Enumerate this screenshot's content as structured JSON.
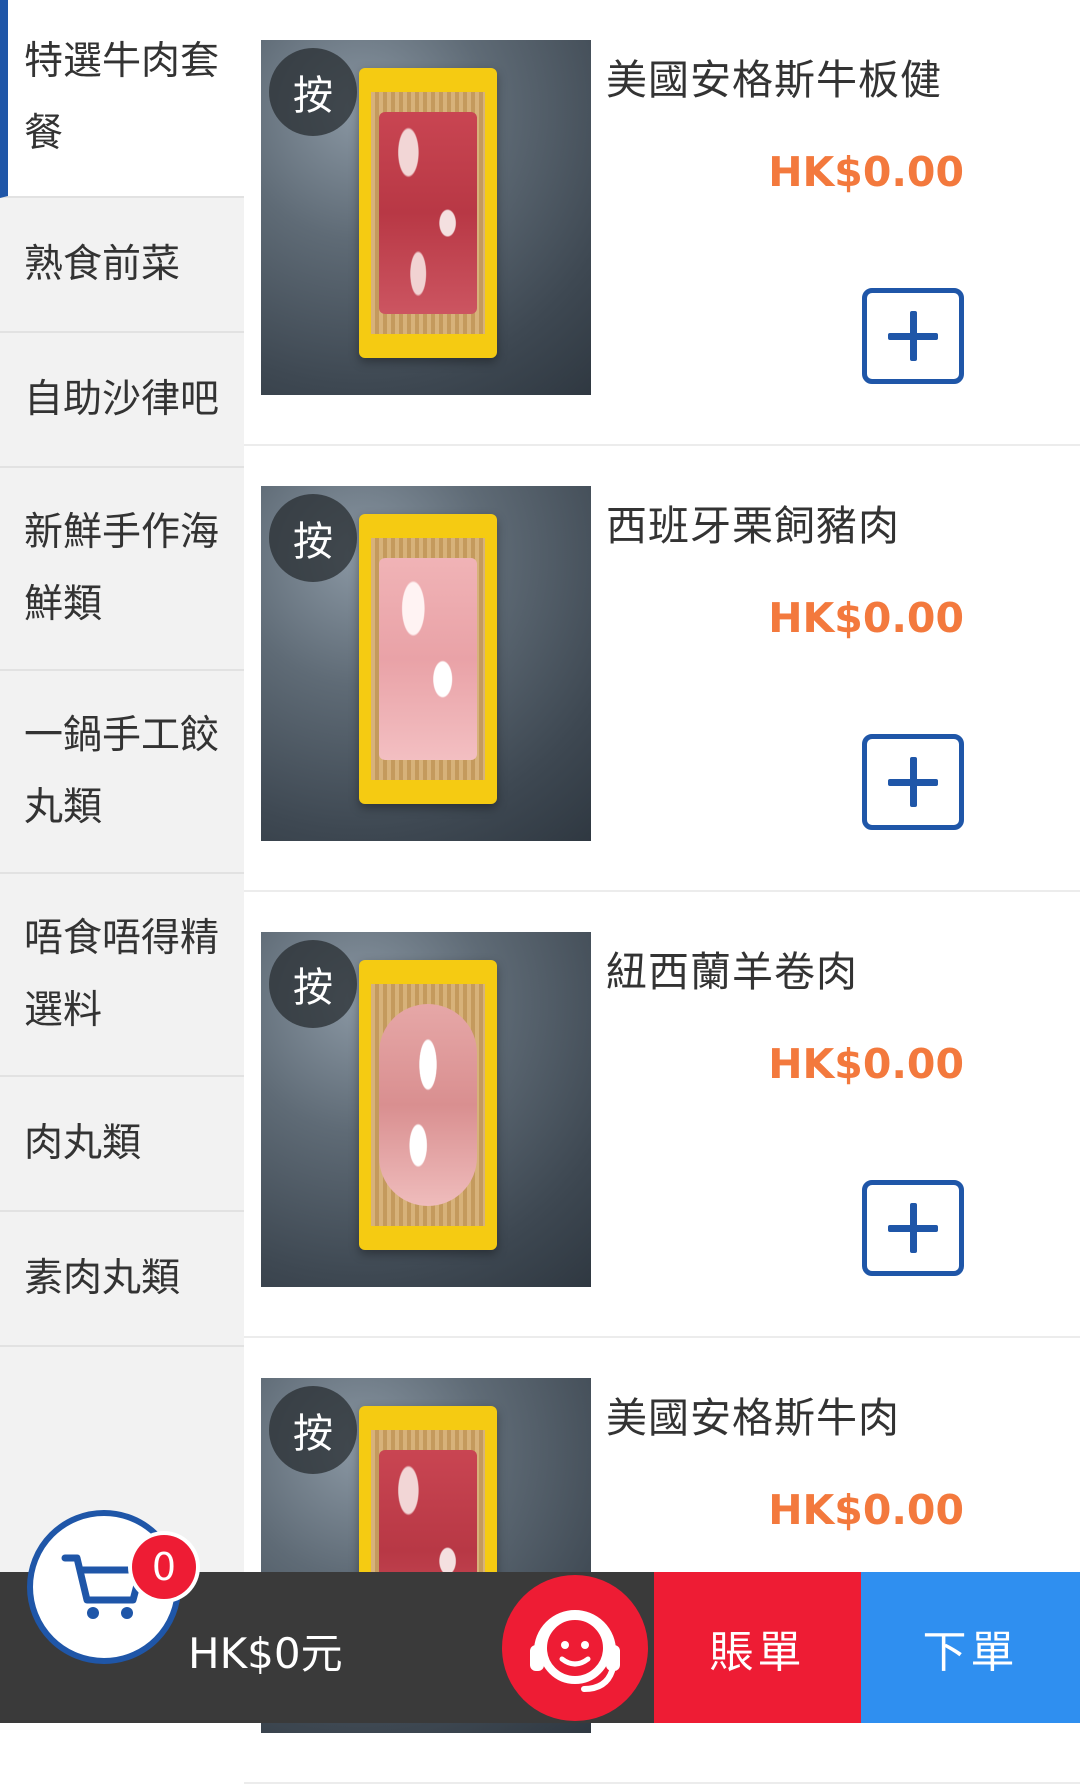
{
  "sidebar": {
    "categories": [
      {
        "label": "特選牛肉套餐",
        "active": true
      },
      {
        "label": "熟食前菜"
      },
      {
        "label": "自助沙律吧"
      },
      {
        "label": "新鮮手作海鮮類"
      },
      {
        "label": "一鍋手工餃丸類"
      },
      {
        "label": "唔食唔得精選料"
      },
      {
        "label": "肉丸類"
      },
      {
        "label": "素肉丸類"
      }
    ]
  },
  "products": [
    {
      "name": "美國安格斯牛板健",
      "price": "HK$0.00",
      "badge": "按",
      "image_icon": "beef-tray"
    },
    {
      "name": "西班牙栗飼豬肉",
      "price": "HK$0.00",
      "badge": "按",
      "image_icon": "pork-tray"
    },
    {
      "name": "紐西蘭羊卷肉",
      "price": "HK$0.00",
      "badge": "按",
      "image_icon": "lamb-tray"
    },
    {
      "name": "美國安格斯牛肉",
      "price": "HK$0.00",
      "badge": "按",
      "image_icon": "beef-tray"
    }
  ],
  "cart": {
    "count": "0",
    "total": "HK$0元",
    "icon": "cart-icon"
  },
  "actions": {
    "bill": "賬單",
    "order": "下單",
    "support_icon": "support-agent-icon"
  },
  "colors": {
    "accent_blue": "#1f56a8",
    "price_orange": "#f3793d",
    "red": "#ee1c34",
    "order_blue": "#2f8ff0"
  }
}
